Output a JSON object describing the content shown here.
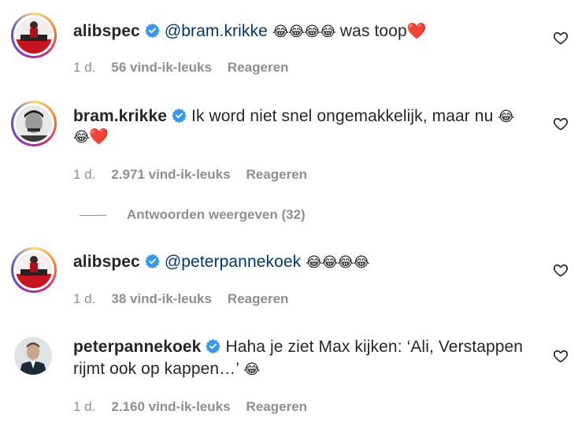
{
  "comments": [
    {
      "username": "alibspec",
      "mention": "@bram.krikke",
      "emoji_text": "😂😂😂😂",
      "text_after": " was toop",
      "heart": "❤️",
      "age": "1 d.",
      "likes": "56 vind-ik-leuks",
      "reply": "Reageren",
      "avatar_icon": "profile-photo-red-car"
    },
    {
      "username": "bram.krikke",
      "text_line1": "Ik word niet snel ongemakkelijk, maar nu ",
      "emoji_end1": "😂",
      "emoji_line2": "😂",
      "heart": "❤️",
      "age": "1 d.",
      "likes": "2.971 vind-ik-leuks",
      "reply": "Reageren",
      "avatar_icon": "profile-photo-bw-portrait"
    },
    {
      "username": "alibspec",
      "mention": "@peterpannekoek",
      "emoji_text": "😂😂😂😂",
      "age": "1 d.",
      "likes": "38 vind-ik-leuks",
      "reply": "Reageren",
      "avatar_icon": "profile-photo-red-car"
    },
    {
      "username": "peterpannekoek",
      "text_line1": "Haha je ziet Max kijken: ‘Ali, Verstappen",
      "text_line2": "rijmt ook op kappen…’ ",
      "emoji_line2": "😂",
      "age": "1 d.",
      "likes": "2.160 vind-ik-leuks",
      "reply": "Reageren",
      "avatar_icon": "profile-photo-man-suit"
    }
  ],
  "view_replies": "Antwoorden weergeven (32)",
  "colors": {
    "mention": "#00376b",
    "verified": "#3897f0",
    "meta": "#8e8e8e",
    "text": "#262626"
  }
}
